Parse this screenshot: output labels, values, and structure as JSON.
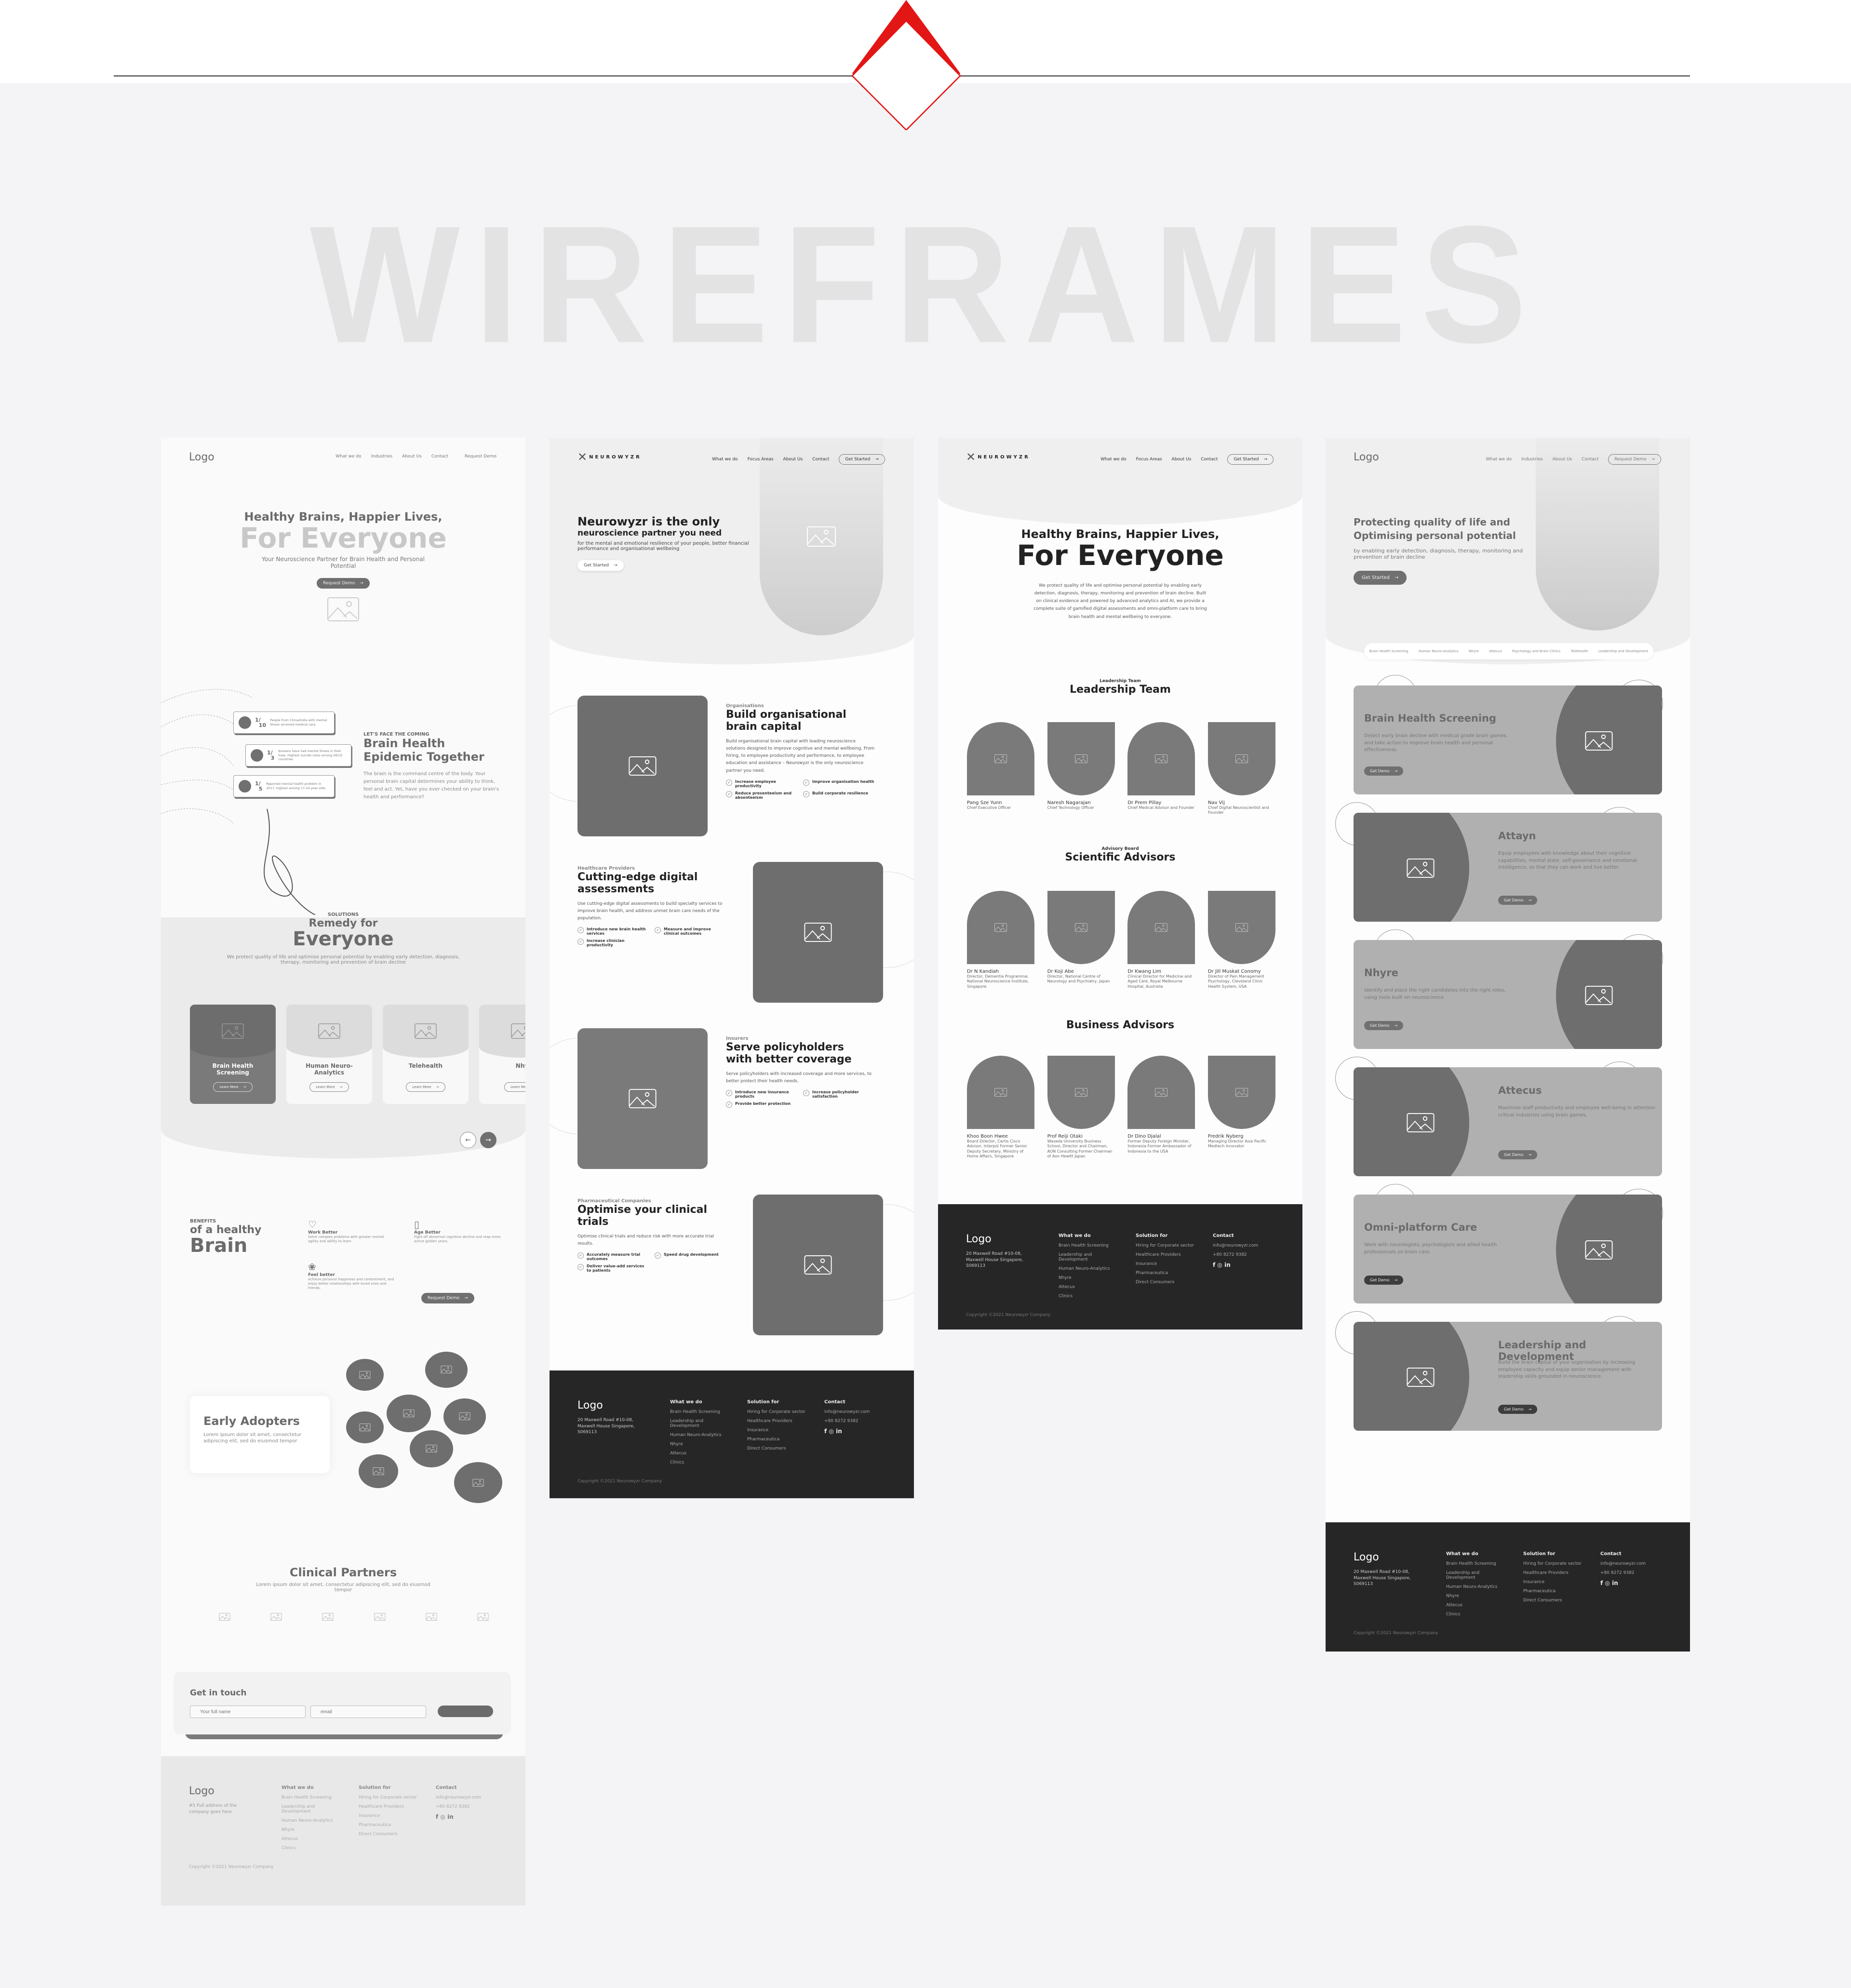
{
  "page": {
    "title": "WIREFRAMES",
    "accent_color": "#e31616"
  },
  "wireframe1": {
    "nav": {
      "logo": "Logo",
      "links": [
        "What we do",
        "Industries",
        "About Us",
        "Contact",
        "Request Demo"
      ]
    },
    "hero": {
      "line1": "Healthy Brains, Happier Lives,",
      "line2": "For Everyone",
      "subtitle": "Your Neuroscience Partner for Brain Health and Personal Potential",
      "cta": "Request Demo"
    },
    "stats": [
      {
        "numerator": "1",
        "denominator": "10",
        "text": "People from China/India with mental illness received medical care."
      },
      {
        "numerator": "1",
        "denominator": "3",
        "text": "Koreans have had mental illness in their lives. Highest suicide rates among OECD countries."
      },
      {
        "numerator": "1",
        "denominator": "5",
        "text": "Reported mental health problem in 2017, highest among 17-24 year olds."
      }
    ],
    "epidemic": {
      "eyebrow": "LET'S FACE THE COMING",
      "title": "Brain Health Epidemic Together",
      "body": "The brain is the command centre of the body. Your personal brain capital determines your ability to think, feel and act. Yet, have you ever checked on your brain's health and performance?"
    },
    "solutions": {
      "eyebrow": "SOLUTIONS",
      "title1": "Remedy for",
      "title2": "Everyone",
      "body": "We protect quality of life and optimise personal potential by enabling early detection, diagnosis, therapy, monitoring and prevention of brain decline",
      "cards": [
        {
          "title": "Brain Health Screening",
          "cta": "Learn More"
        },
        {
          "title": "Human Neuro-Analytics",
          "cta": "Learn More"
        },
        {
          "title": "Telehealth",
          "cta": "Learn More"
        },
        {
          "title": "Nhy",
          "cta": "Learn Mo"
        }
      ]
    },
    "benefits": {
      "eyebrow": "BENEFITS",
      "title1": "of a healthy",
      "title2": "Brain",
      "items": [
        {
          "icon": "heart-hands-icon",
          "title": "Work Better",
          "text": "Solve complex problems with greater mental agility and ability to learn."
        },
        {
          "icon": "phone-pulse-icon",
          "title": "Age Better",
          "text": "Fight off abnormal cognitive decline and reap more active golden years."
        },
        {
          "icon": "brain-icon",
          "title": "Feel better",
          "text": "Achieve personal happiness and contentment, and enjoy better relationships with loved ones and friends."
        }
      ],
      "cta": "Request Demo"
    },
    "early_adopters": {
      "title": "Early Adopters",
      "body": "Lorem ipsum dolor sit amet, consectetur adipiscing elit, sed do eiusmod tempor"
    },
    "clinical_partners": {
      "title": "Clinical Partners",
      "body": "Lorem ipsum dolor sit amet, consectetur adipiscing elit, sed do eiusmod tempor",
      "logo_count": 6
    },
    "contact": {
      "title": "Get in touch",
      "name_placeholder": "Your full name",
      "email_placeholder": "email"
    },
    "footer": {
      "logo": "Logo",
      "address": "#5 Full address of the company goes here",
      "copyright": "Copyright ©2021 Neurowyzr Company"
    }
  },
  "wireframe2": {
    "nav": {
      "brand": "NEUROWYZR",
      "links": [
        "What we do",
        "Focus Areas",
        "About Us",
        "Contact"
      ],
      "cta": "Get Started"
    },
    "hero": {
      "line1": "Neurowyzr is the only",
      "line2": "neuroscience partner you need",
      "subtitle": "for the mental and emotional resilience of your people, better financial performance and organisational wellbeing",
      "cta": "Get Started"
    },
    "sections": [
      {
        "eyebrow": "Organisations",
        "title": "Build organisational brain capital",
        "body": "Build organisational brain capital with leading neuroscience solutions designed to improve cognitive and mental wellbeing. From hiring, to employee productivity and performance, to employee education and assistance – Neurowyzr is the only neuroscience partner you need.",
        "checks": [
          "Increase employee productivity",
          "Improve organisation health",
          "Reduce presenteeism and absenteeism",
          "Build corporate resilience"
        ]
      },
      {
        "eyebrow": "Healthcare Providers",
        "title": "Cutting-edge digital assessments",
        "body": "Use cutting-edge digital assessments to build specialty services to improve brain health, and address unmet brain care needs of the population.",
        "checks": [
          "Introduce new brain health services",
          "Measure and improve clinical outcomes",
          "Increase clinician productivity"
        ]
      },
      {
        "eyebrow": "Insurers",
        "title": "Serve policyholders with better coverage",
        "body": "Serve policyholders with increased coverage and more services, to better protect their health needs.",
        "checks": [
          "Introduce new insurance products",
          "Increase policyholder satisfaction",
          "Provide better protection"
        ]
      },
      {
        "eyebrow": "Pharmaceutical Companies",
        "title": "Optimise your clinical trials",
        "body": "Optimise clinical trials and reduce risk with more accurate trial results.",
        "checks": [
          "Accurately measure trial outcomes",
          "Speed drug development",
          "Deliver value-add services to patients"
        ]
      }
    ]
  },
  "wireframe3": {
    "nav": {
      "brand": "NEUROWYZR",
      "links": [
        "What we do",
        "Focus Areas",
        "About Us",
        "Contact"
      ],
      "cta": "Get Started"
    },
    "hero": {
      "line1": "Healthy Brains, Happier Lives,",
      "line2": "For Everyone",
      "body": "We protect quality of life and optimise personal potential by enabling early detection, diagnosis, therapy, monitoring and prevention of brain decline.  Built on clinical evidence and powered by advanced  analytics and AI, we provide a complete suite of gamified digital assessments and omni-platform care to bring brain  health and mental wellbeing to everyone."
    },
    "leadership": {
      "eyebrow": "Leadership Team",
      "title": "Leadership Team",
      "members": [
        {
          "name": "Pang Sze Yunn",
          "role": "Chief Executive Officer"
        },
        {
          "name": "Naresh Nagarajan",
          "role": "Chief Technology Officer"
        },
        {
          "name": "Dr Prem Pillay",
          "role": "Chief Medical Advisor and Founder"
        },
        {
          "name": "Nav Vij",
          "role": "Chief Digital Neuroscientist and Founder"
        }
      ]
    },
    "scientific": {
      "eyebrow": "Advisory Board",
      "title": "Scientific Advisors",
      "members": [
        {
          "name": "Dr N Kandiah",
          "role": "Director, Dementia Programme, National Neuroscience Institute, Singapore"
        },
        {
          "name": "Dr Koji Abe",
          "role": "Director, National Centre of Neurology and Psychiatry, Japan"
        },
        {
          "name": "Dr Kwang Lim",
          "role": "Clinical Director for Medicine and Aged Care, Royal Melbourne Hospital, Australia"
        },
        {
          "name": "Dr Jill Muskat Conomy",
          "role": "Director of Pain Management Psychology, Cleveland Clinic Health System, USA"
        }
      ]
    },
    "business": {
      "title": "Business Advisors",
      "members": [
        {
          "name": "Khoo Boon Hwee",
          "role": "Board Director, Certis Cisco Advisor, Interpol Former Senior Deputy Secretary, Ministry of Home Affairs, Singapore"
        },
        {
          "name": "Prof Reiji Otaki",
          "role": "Waseda University Business School, Director and Chairman, AON Consulting Former Chairman of Aon Hewitt Japan"
        },
        {
          "name": "Dr Dino Djalal",
          "role": "Former Deputy Foreign Minister, Indonesia Former Ambassador of Indonesia to the USA"
        },
        {
          "name": "Fredrik Nyberg",
          "role": "Managing Director Asia Pacific Medtech Innovator"
        }
      ]
    }
  },
  "wireframe4": {
    "nav": {
      "logo": "Logo",
      "links": [
        "What we do",
        "Industries",
        "About Us",
        "Contact"
      ],
      "cta": "Request Demo"
    },
    "hero": {
      "line1": "Protecting quality of life and",
      "line2": "Optimising personal potential",
      "subtitle": "by enabling early detection, diagnosis, therapy, monitoring and prevention of brain decline",
      "cta": "Get Started"
    },
    "tabs": [
      "Brain Health Screening",
      "Human Neuro-Analytics",
      "Nhyre",
      "Attecus",
      "Psychology and Brain Clinics",
      "Telehealth",
      "Leadership and Development"
    ],
    "services": [
      {
        "title": "Brain Health Screening",
        "body": "Detect early brain decline with medical grade brain games, and take action to improve brain health and personal effectiveness.",
        "cta": "Get Demo",
        "image_side": "right"
      },
      {
        "title": "Attayn",
        "body": "Equip employees with knowledge about their cognitive capabilities, mental state, self-governance and emotional intelligence, so that they can work and live better.",
        "cta": "Get Demo",
        "image_side": "left"
      },
      {
        "title": "Nhyre",
        "body": "Identify and place the right candidates into the right roles, using tools built on neuroscience.",
        "cta": "Get Demo",
        "image_side": "right"
      },
      {
        "title": "Attecus",
        "body": "Maximise staff productivity and employee well-being in attention critical industries using brain games.",
        "cta": "Get Demo",
        "image_side": "left"
      },
      {
        "title": "Omni-platform Care",
        "body": "Work with neurologists, psychologists and allied health professionals on brain care.",
        "cta": "Get Demo",
        "image_side": "right"
      },
      {
        "title": "Leadership and Development",
        "body": "Build the brain capital of your organisation by increasing employee capacity and equip senior management with leadership skills grounded in neuroscience.",
        "cta": "Get Demo",
        "image_side": "left"
      }
    ]
  },
  "dark_footer": {
    "logo": "Logo",
    "address": "20 Maxwell Road #10-08, Maxwell House Singapore, S069113",
    "copyright": "Copyright ©2021 Neurowyzr Company"
  },
  "footer_columns": [
    {
      "heading": "What we do",
      "items": [
        "Brain Health Screening",
        "Leadership and Development",
        "Human Neuro-Analytics",
        "Nhyre",
        "Attecus",
        "Clinics"
      ]
    },
    {
      "heading": "Solution for",
      "items": [
        "Hiring for Corporate sector",
        "Healthcare Providers",
        "Insurance",
        "Pharmaceutica",
        "Direct Consumers"
      ]
    },
    {
      "heading": "Contact",
      "items": [
        "info@neurowyzr.com",
        "+80 8272 9382"
      ]
    }
  ],
  "social_icons": [
    "facebook-icon",
    "instagram-icon",
    "linkedin-icon"
  ]
}
